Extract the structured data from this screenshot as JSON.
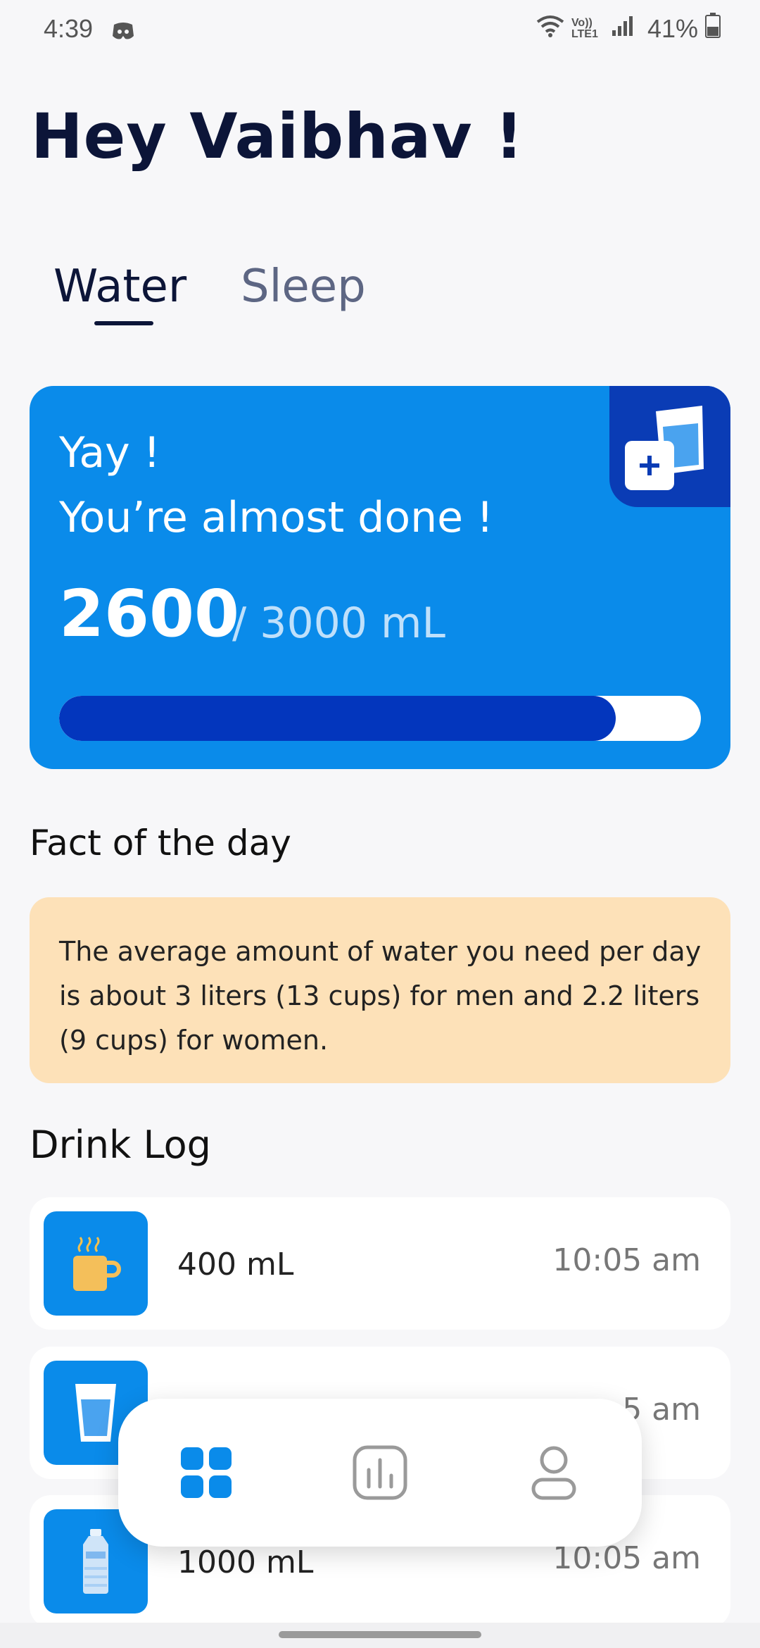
{
  "status_bar": {
    "time": "4:39",
    "network": "Vo)) LTE1",
    "battery": "41%"
  },
  "greeting": "Hey Vaibhav !",
  "tabs": [
    {
      "label": "Water",
      "active": true
    },
    {
      "label": "Sleep",
      "active": false
    }
  ],
  "progress_card": {
    "line1": "Yay !",
    "line2": "You’re almost done !",
    "current": "2600",
    "goal_text": "/ 3000 mL",
    "progress_fraction": 0.867,
    "colors": {
      "card": "#0a8bea",
      "fill": "#0336bd",
      "button": "#0a3cb5"
    }
  },
  "fact": {
    "heading": "Fact of the day",
    "text": "The average amount of water you need per day is about 3 liters (13 cups) for men and 2.2 liters (9 cups) for women."
  },
  "drink_log": {
    "heading": "Drink Log",
    "items": [
      {
        "icon": "coffee-mug-icon",
        "amount": "400 mL",
        "time": "10:05 am"
      },
      {
        "icon": "water-glass-icon",
        "amount": "",
        "time": "5 am"
      },
      {
        "icon": "water-bottle-icon",
        "amount": "1000 mL",
        "time": "10:05 am"
      }
    ]
  },
  "bottom_nav": [
    {
      "icon": "dashboard-icon",
      "active": true
    },
    {
      "icon": "stats-icon",
      "active": false
    },
    {
      "icon": "profile-icon",
      "active": false
    }
  ]
}
